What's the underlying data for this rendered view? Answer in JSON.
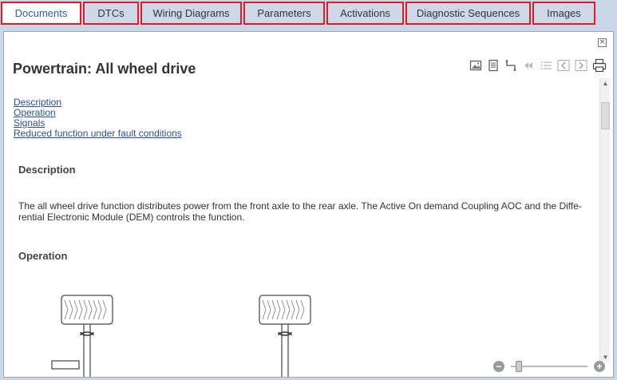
{
  "tabs": [
    {
      "label": "Documents",
      "active": true
    },
    {
      "label": "DTCs",
      "active": false
    },
    {
      "label": "Wiring Diagrams",
      "active": false
    },
    {
      "label": "Parameters",
      "active": false
    },
    {
      "label": "Activations",
      "active": false
    },
    {
      "label": "Diagnostic Sequences",
      "active": false
    },
    {
      "label": "Images",
      "active": false
    }
  ],
  "page": {
    "title": "Powertrain: All wheel drive",
    "toc": [
      "Description",
      "Operation",
      "Signals",
      "Reduced function under fault conditions"
    ],
    "sections": {
      "description_heading": "Description",
      "description_text_line1": "The all wheel drive function distributes power from the front axle to the rear axle. The Active On demand Coupling AOC and the Diffe-",
      "description_text_line2": "rential Electronic Module (DEM) controls the function.",
      "operation_heading": "Operation"
    }
  },
  "toolbar": {
    "icons": [
      "image-icon",
      "document-icon",
      "connector-icon",
      "first-page-icon",
      "list-icon",
      "prev-icon",
      "next-icon",
      "print-icon"
    ]
  },
  "zoom": {
    "minus": "−",
    "plus": "+",
    "level": 0.12
  },
  "colors": {
    "tab_border": "#e01b24",
    "link": "#2d4fa0",
    "active_tab_text": "#2f5fa8"
  }
}
